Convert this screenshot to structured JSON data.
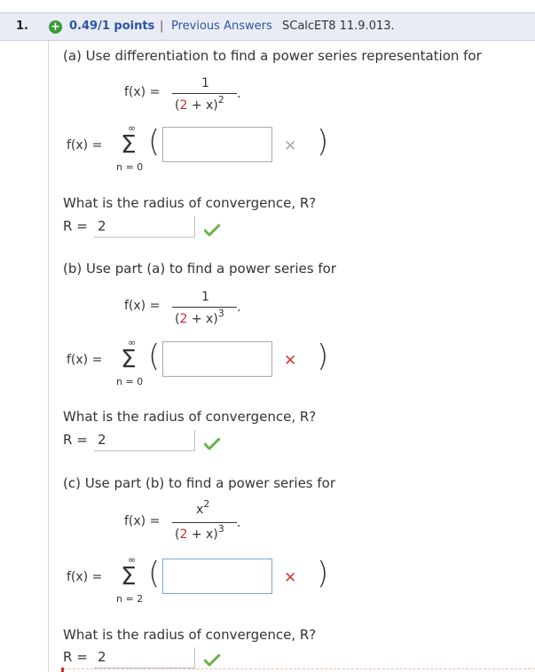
{
  "header": {
    "question_number": "1.",
    "points": "0.49/1 points",
    "separator": "|",
    "previous_answers": "Previous Answers",
    "source": "SCalcET8 11.9.013."
  },
  "part_a": {
    "prompt": "(a) Use differentiation to find a power series representation for",
    "fx": "f(x) =",
    "numerator": "1",
    "den_open": "(",
    "den_two": "2",
    "den_rest": " + x)",
    "den_exp": "2",
    "period": ".",
    "series_label": "f(x) =",
    "sigma": "Σ",
    "upper": "∞",
    "lower": "n = 0",
    "answer_value": "",
    "mark": "✕",
    "radius_question": "What is the radius of convergence, R?",
    "r_label": "R =",
    "r_value": "2"
  },
  "part_b": {
    "prompt": "(b) Use part (a) to find a power series for",
    "fx": "f(x) =",
    "numerator": "1",
    "den_open": "(",
    "den_two": "2",
    "den_rest": " + x)",
    "den_exp": "3",
    "period": ".",
    "series_label": "f(x) =",
    "sigma": "Σ",
    "upper": "∞",
    "lower": "n = 0",
    "answer_value": "",
    "mark": "✕",
    "radius_question": "What is the radius of convergence, R?",
    "r_label": "R =",
    "r_value": "2"
  },
  "part_c": {
    "prompt": "(c) Use part (b) to find a power series for",
    "fx": "f(x) =",
    "numerator": "x",
    "num_exp": "2",
    "den_open": "(",
    "den_two": "2",
    "den_rest": " + x)",
    "den_exp": "3",
    "period": ".",
    "series_label": "f(x) =",
    "sigma": "Σ",
    "upper": "∞",
    "lower": "n = 2",
    "answer_value": "",
    "mark": "✕",
    "radius_question": "What is the radius of convergence, R?",
    "r_label": "R =",
    "r_value": "2"
  },
  "icons": {
    "status": "plus-circle-icon",
    "incorrect": "x-mark-icon",
    "correct": "checkmark-icon"
  },
  "colors": {
    "header_bg": "#eaecf5",
    "link_blue": "#2a55a8",
    "correct_green": "#6ab04c",
    "incorrect_red": "#d63a3a",
    "highlight_red": "#d42b2b"
  }
}
